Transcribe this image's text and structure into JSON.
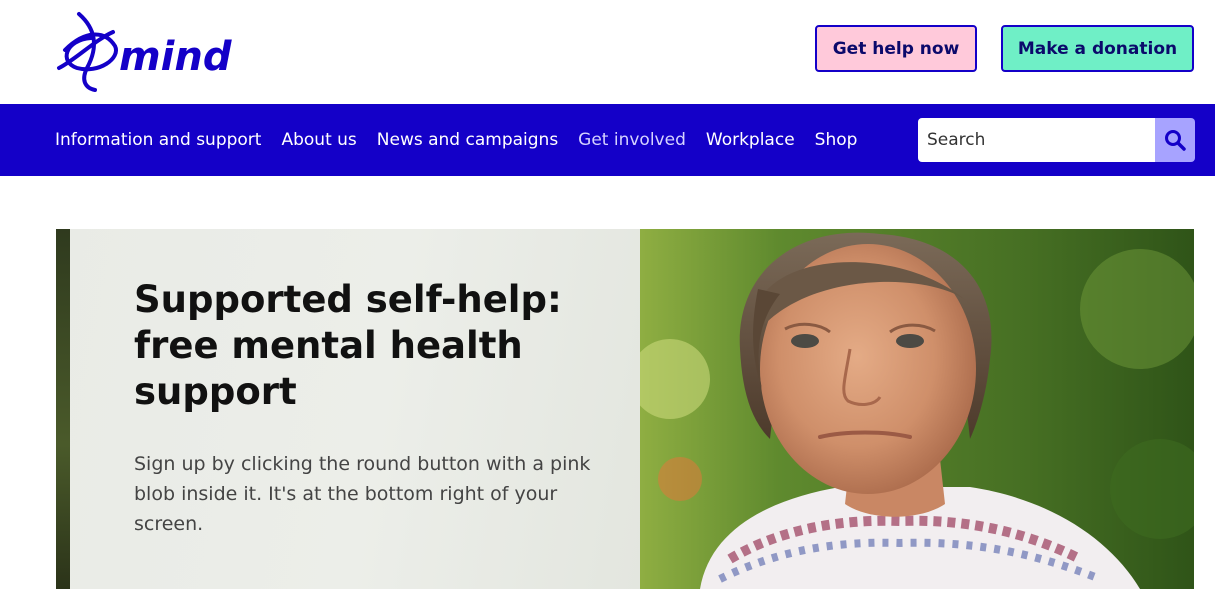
{
  "brand": {
    "logo_text": "mind",
    "color": "#1400c8"
  },
  "header": {
    "help_button": "Get help now",
    "donate_button": "Make a donation"
  },
  "nav": {
    "items": [
      "Information and support",
      "About us",
      "News and campaigns",
      "Get involved",
      "Workplace",
      "Shop"
    ]
  },
  "search": {
    "placeholder": "Search",
    "icon": "search-icon"
  },
  "hero": {
    "title": "Supported self-help: free mental health support",
    "subtitle": "Sign up by clicking the round button with a pink blob inside it. It's at the bottom right of your screen."
  },
  "colors": {
    "nav_bg": "#1400c8",
    "help_bg": "#ffc9da",
    "donate_bg": "#6fefc6",
    "search_button_bg": "#a7a3ff"
  }
}
